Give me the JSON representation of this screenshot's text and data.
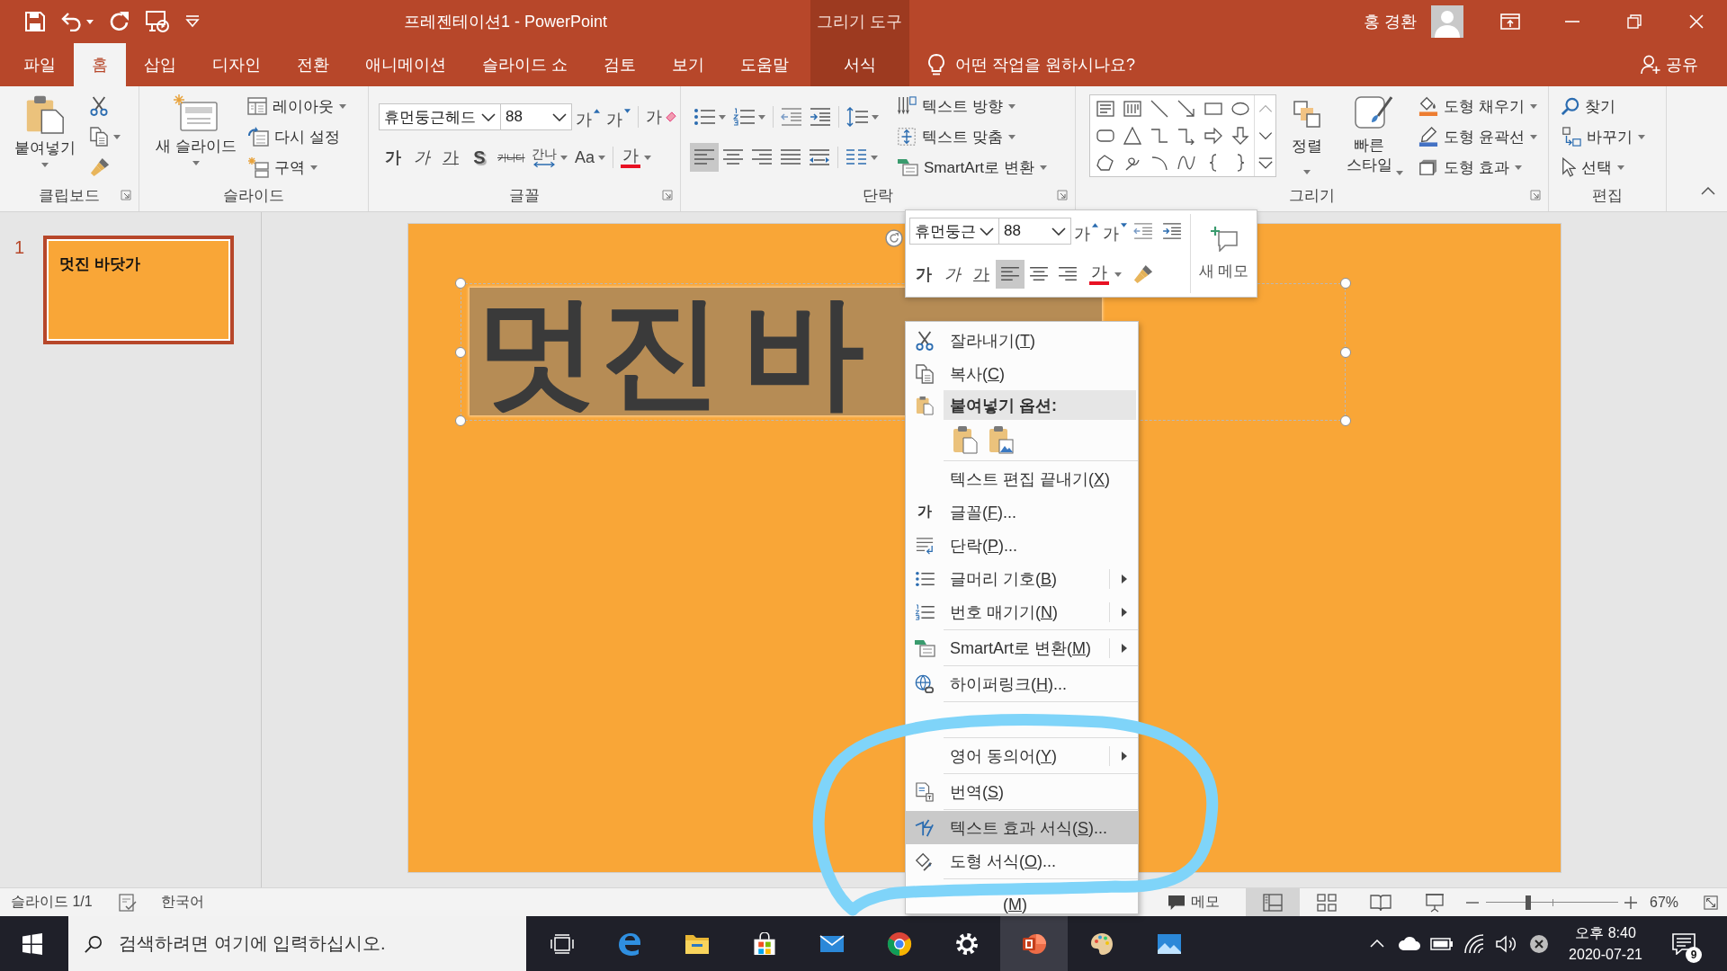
{
  "window": {
    "title": "프레젠테이션1 - PowerPoint",
    "context_group": "그리기 도구",
    "user": "홍 경환"
  },
  "tabs": [
    {
      "label": "파일",
      "selected": false,
      "kind": "standard"
    },
    {
      "label": "홈",
      "selected": true,
      "kind": "standard"
    },
    {
      "label": "삽입",
      "selected": false,
      "kind": "standard"
    },
    {
      "label": "디자인",
      "selected": false,
      "kind": "standard"
    },
    {
      "label": "전환",
      "selected": false,
      "kind": "standard"
    },
    {
      "label": "애니메이션",
      "selected": false,
      "kind": "standard"
    },
    {
      "label": "슬라이드 쇼",
      "selected": false,
      "kind": "standard"
    },
    {
      "label": "검토",
      "selected": false,
      "kind": "standard"
    },
    {
      "label": "보기",
      "selected": false,
      "kind": "standard"
    },
    {
      "label": "도움말",
      "selected": false,
      "kind": "standard"
    },
    {
      "label": "서식",
      "selected": false,
      "kind": "contextual"
    }
  ],
  "tell_me": {
    "placeholder": "어떤 작업을 원하시나요?"
  },
  "share": {
    "label": "공유"
  },
  "ribbon": {
    "clipboard": {
      "label": "클립보드",
      "paste": "붙여넣기"
    },
    "slides": {
      "label": "슬라이드",
      "new_slide": "새 슬라이드",
      "layout": "레이아웃",
      "reset": "다시 설정",
      "section": "구역"
    },
    "font": {
      "label": "글꼴",
      "font_name": "휴먼둥근헤드",
      "font_size": "88",
      "grow": "가",
      "shrink": "가",
      "clear": "가",
      "bold": "가",
      "italic": "가",
      "underline": "가",
      "shadow": "S",
      "strikethrough": "가나다",
      "spacing": "간나",
      "change_case": "Aa",
      "font_color": "가"
    },
    "paragraph": {
      "label": "단락",
      "alignment": [
        {
          "selected": true
        },
        {
          "selected": false
        },
        {
          "selected": false
        },
        {
          "selected": false
        },
        {
          "selected": false
        }
      ],
      "text_direction": "텍스트 방향",
      "align_text": "텍스트 맞춤",
      "smartart": "SmartArt로 변환"
    },
    "drawing": {
      "label": "그리기",
      "arrange": "정렬",
      "quick_styles": "빠른 스타일",
      "shape_fill": "도형 채우기",
      "shape_outline": "도형 윤곽선",
      "shape_effects": "도형 효과"
    },
    "editing": {
      "label": "편집",
      "find": "찾기",
      "replace": "바꾸기",
      "select": "선택"
    }
  },
  "thumbnails": [
    {
      "number": "1",
      "title": "멋진 바닷가",
      "selected": true
    }
  ],
  "slide": {
    "title": "멋진 바"
  },
  "mini_toolbar": {
    "font_name": "휴먼둥근",
    "font_size": "88",
    "grow": "가",
    "shrink": "가",
    "bold": "가",
    "italic": "가",
    "underline": "가",
    "alignment": [
      {
        "selected": true
      },
      {
        "selected": false
      },
      {
        "selected": false
      }
    ],
    "font_color": "가",
    "new_comment": "새 메모"
  },
  "context_menu": [
    {
      "kind": "item",
      "label": "잘라내기(",
      "hotkey": "T",
      "suffix": ")",
      "submenu": false,
      "selected": false
    },
    {
      "kind": "item",
      "label": "복사(",
      "hotkey": "C",
      "suffix": ")",
      "submenu": false,
      "selected": false
    },
    {
      "kind": "header",
      "label": "붙여넣기 옵션:"
    },
    {
      "kind": "paste_options"
    },
    {
      "kind": "separator"
    },
    {
      "kind": "item",
      "label": "텍스트 편집 끝내기(",
      "hotkey": "X",
      "suffix": ")",
      "submenu": false,
      "selected": false
    },
    {
      "kind": "item",
      "glyph": "가",
      "label": "글꼴(",
      "hotkey": "F",
      "suffix": ")...",
      "submenu": false,
      "selected": false
    },
    {
      "kind": "item",
      "label": "단락(",
      "hotkey": "P",
      "suffix": ")...",
      "submenu": false,
      "selected": false
    },
    {
      "kind": "item",
      "label": "글머리 기호(",
      "hotkey": "B",
      "suffix": ")",
      "submenu": true,
      "selected": false
    },
    {
      "kind": "item",
      "label": "번호 매기기(",
      "hotkey": "N",
      "suffix": ")",
      "submenu": true,
      "selected": false
    },
    {
      "kind": "separator"
    },
    {
      "kind": "item",
      "label": "SmartArt로 변환(",
      "hotkey": "M",
      "suffix": ")",
      "submenu": true,
      "selected": false
    },
    {
      "kind": "separator"
    },
    {
      "kind": "item",
      "label": "하이퍼링크(",
      "hotkey": "H",
      "suffix": ")...",
      "submenu": false,
      "selected": false
    },
    {
      "kind": "separator"
    },
    {
      "kind": "covered"
    },
    {
      "kind": "separator"
    },
    {
      "kind": "item",
      "label": "영어 동의어(",
      "hotkey": "Y",
      "suffix": ")",
      "submenu": true,
      "selected": false
    },
    {
      "kind": "separator"
    },
    {
      "kind": "item",
      "label": "번역(",
      "hotkey": "S",
      "suffix": ")",
      "submenu": false,
      "selected": false
    },
    {
      "kind": "separator"
    },
    {
      "kind": "item",
      "label": "텍스트 효과 서식(",
      "hotkey": "S",
      "suffix": ")...",
      "submenu": false,
      "selected": true
    },
    {
      "kind": "item",
      "label": "도형 서식(",
      "hotkey": "O",
      "suffix": ")...",
      "submenu": false,
      "selected": false
    },
    {
      "kind": "separator"
    },
    {
      "kind": "partial",
      "label": "(",
      "hotkey": "M",
      "suffix": ")",
      "selected": false
    }
  ],
  "status_bar": {
    "slide": "슬라이드 1/1",
    "language": "한국어",
    "notes": "메모",
    "views": [
      {
        "selected": true
      },
      {
        "selected": false
      },
      {
        "selected": false
      },
      {
        "selected": false
      }
    ],
    "zoom": {
      "level": 0.32,
      "reading": "67%"
    }
  },
  "taskbar": {
    "search": {
      "placeholder": "검색하려면 여기에 입력하십시오."
    },
    "apps": [
      {
        "selected": false
      },
      {
        "selected": false
      },
      {
        "selected": false
      },
      {
        "selected": false
      },
      {
        "selected": false
      },
      {
        "selected": false
      },
      {
        "selected": true
      },
      {
        "selected": false
      },
      {
        "selected": false
      }
    ],
    "time": "오후 8:40",
    "date": "2020-07-21",
    "notifications": "9"
  }
}
